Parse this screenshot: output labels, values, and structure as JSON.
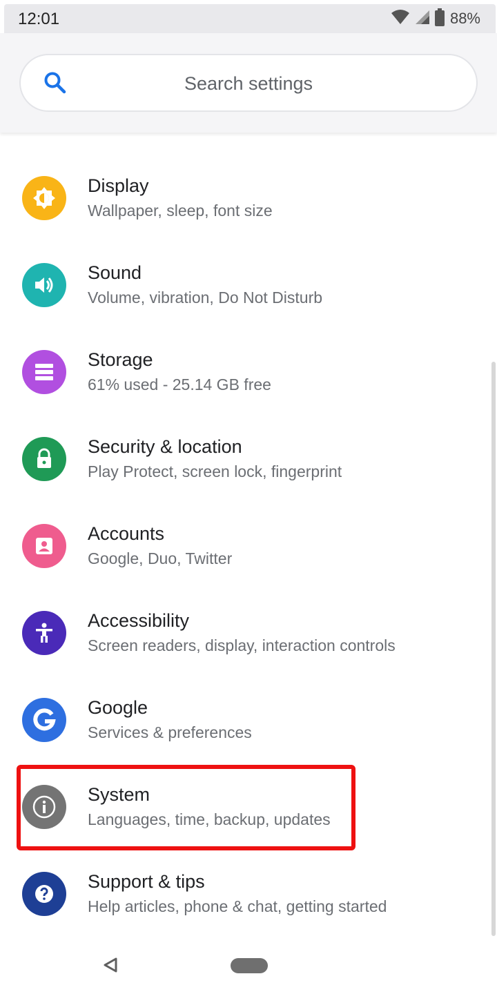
{
  "status_bar": {
    "time": "12:01",
    "battery_percent": "88%",
    "icons": [
      "wifi-icon",
      "cell-signal-icon",
      "battery-icon"
    ]
  },
  "search": {
    "placeholder": "Search settings",
    "icon": "search-icon"
  },
  "settings_items": [
    {
      "title": "Display",
      "subtitle": "Wallpaper, sleep, font size",
      "icon": "brightness-icon",
      "color": "#f9b417"
    },
    {
      "title": "Sound",
      "subtitle": "Volume, vibration, Do Not Disturb",
      "icon": "volume-icon",
      "color": "#1fb4b0"
    },
    {
      "title": "Storage",
      "subtitle": "61% used - 25.14 GB free",
      "icon": "storage-icon",
      "color": "#b14fe0"
    },
    {
      "title": "Security & location",
      "subtitle": "Play Protect, screen lock, fingerprint",
      "icon": "lock-icon",
      "color": "#1f9a56"
    },
    {
      "title": "Accounts",
      "subtitle": "Google, Duo, Twitter",
      "icon": "account-icon",
      "color": "#ef5c8e"
    },
    {
      "title": "Accessibility",
      "subtitle": "Screen readers, display, interaction controls",
      "icon": "accessibility-icon",
      "color": "#4a2ab8"
    },
    {
      "title": "Google",
      "subtitle": "Services & preferences",
      "icon": "google-icon",
      "color": "#2e6fe0"
    },
    {
      "title": "System",
      "subtitle": "Languages, time, backup, updates",
      "icon": "info-icon",
      "color": "#747474"
    },
    {
      "title": "Support & tips",
      "subtitle": "Help articles, phone & chat, getting started",
      "icon": "help-icon",
      "color": "#1e3f95"
    }
  ],
  "highlighted_item": "System",
  "highlight_color": "#ee1111",
  "nav_bar": {
    "back_icon": "back-triangle-icon",
    "home_icon": "home-pill-icon"
  }
}
